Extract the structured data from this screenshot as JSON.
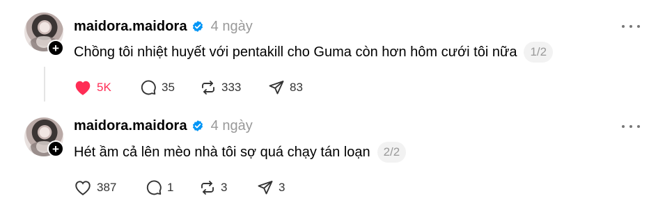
{
  "colors": {
    "like_red": "#ff2d55",
    "verified_blue": "#0095f6",
    "muted": "#999999"
  },
  "icons": {
    "follow": "plus-icon",
    "verified": "verified-badge-icon",
    "more": "more-horizontal-icon",
    "like": "heart-icon",
    "reply": "comment-bubble-icon",
    "repost": "repost-icon",
    "share": "send-icon"
  },
  "posts": [
    {
      "username": "maidora.maidora",
      "time": "4 ngày",
      "text": "Chồng tôi nhiệt huyết với pentakill cho Guma còn hơn hôm cưới tôi nữa",
      "pager": "1/2",
      "liked": true,
      "likes": "5K",
      "replies": "35",
      "reposts": "333",
      "shares": "83"
    },
    {
      "username": "maidora.maidora",
      "time": "4 ngày",
      "text": "Hét ầm cả lên mèo nhà tôi sợ quá chạy tán loạn",
      "pager": "2/2",
      "liked": false,
      "likes": "387",
      "replies": "1",
      "reposts": "3",
      "shares": "3"
    }
  ]
}
